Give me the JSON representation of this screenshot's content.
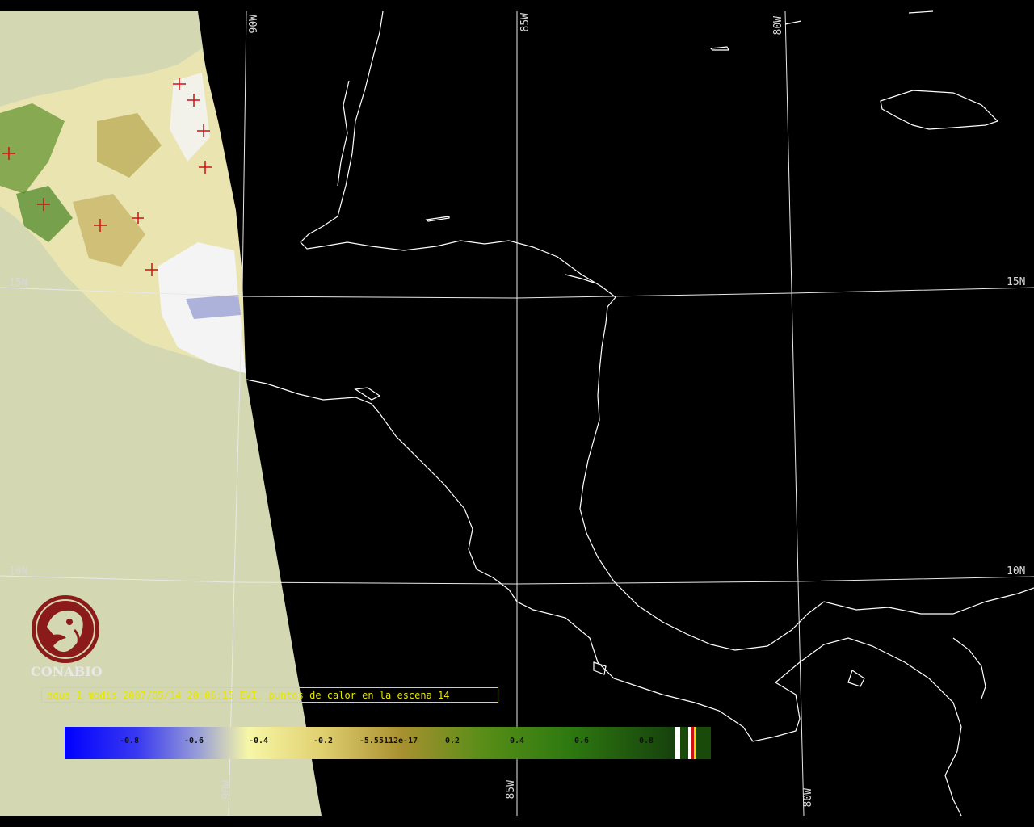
{
  "map": {
    "grid_labels": {
      "lon": [
        "90W",
        "85W",
        "80W"
      ],
      "lat": [
        "15N",
        "10N"
      ]
    },
    "colors": {
      "background": "#000000",
      "unscanned_area": "#d3d8b2",
      "coastline": "#ffffff",
      "graticule": "#e8e8e8",
      "hotspot_marker": "#d01010"
    }
  },
  "logo": {
    "text": "CONABIO",
    "icon": "conabio-macaw-logo-icon",
    "color": "#8b1a1a"
  },
  "caption": {
    "text": "aqua-1 modis 2007/05/14 20:06:15 EVI, puntos de calor en la escena 14"
  },
  "colorbar": {
    "ticks": [
      "-0.8",
      "-0.6",
      "-0.4",
      "-0.2",
      "-5.55112e-17",
      "0.2",
      "0.4",
      "0.6",
      "0.8"
    ],
    "tick_values": [
      -0.8,
      -0.6,
      -0.4,
      -0.2,
      0,
      0.2,
      0.4,
      0.6,
      0.8
    ],
    "range": [
      -1.0,
      1.0
    ],
    "gradient_colors": [
      "#0000ff",
      "#9aa0d6",
      "#f7f7a6",
      "#d8c060",
      "#9a8a30",
      "#4a8a14",
      "#2e7a10",
      "#1c4a10"
    ],
    "flag_colors": [
      "#ffffff",
      "#1a4a0a",
      "#ffffff",
      "#d01010",
      "#e6e600"
    ]
  }
}
